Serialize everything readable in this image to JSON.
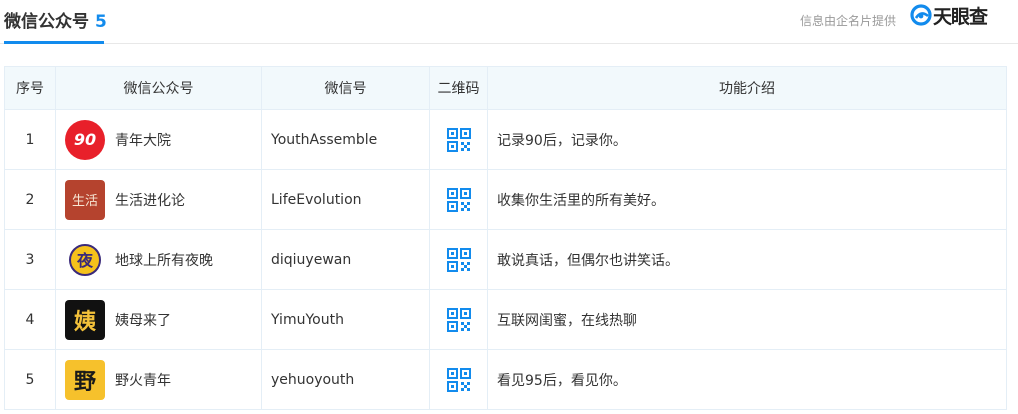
{
  "header": {
    "title": "微信公众号",
    "count": "5",
    "source": "信息由企名片提供",
    "brand": "天眼查"
  },
  "colors": {
    "accent": "#128bed",
    "header_bg": "#f2f9fc",
    "border": "#e4eef6"
  },
  "table": {
    "columns": [
      "序号",
      "微信公众号",
      "微信号",
      "二维码",
      "功能介绍"
    ],
    "rows": [
      {
        "index": "1",
        "name": "青年大院",
        "wechat_id": "YouthAssemble",
        "description": "记录90后，记录你。",
        "avatar_text": "90",
        "avatar_icon": "youth-assemble-logo",
        "qr_icon": "qr-code-icon"
      },
      {
        "index": "2",
        "name": "生活进化论",
        "wechat_id": "LifeEvolution",
        "description": "收集你生活里的所有美好。",
        "avatar_text": "生活",
        "avatar_icon": "life-evolution-logo",
        "qr_icon": "qr-code-icon"
      },
      {
        "index": "3",
        "name": "地球上所有夜晚",
        "wechat_id": "diqiuyewan",
        "description": "敢说真话，但偶尔也讲笑话。",
        "avatar_text": "夜",
        "avatar_icon": "night-logo",
        "qr_icon": "qr-code-icon"
      },
      {
        "index": "4",
        "name": "姨母来了",
        "wechat_id": "YimuYouth",
        "description": "互联网闺蜜，在线热聊",
        "avatar_text": "姨",
        "avatar_icon": "yimu-logo",
        "qr_icon": "qr-code-icon"
      },
      {
        "index": "5",
        "name": "野火青年",
        "wechat_id": "yehuoyouth",
        "description": "看见95后，看见你。",
        "avatar_text": "野",
        "avatar_icon": "wildfire-logo",
        "qr_icon": "qr-code-icon"
      }
    ]
  }
}
